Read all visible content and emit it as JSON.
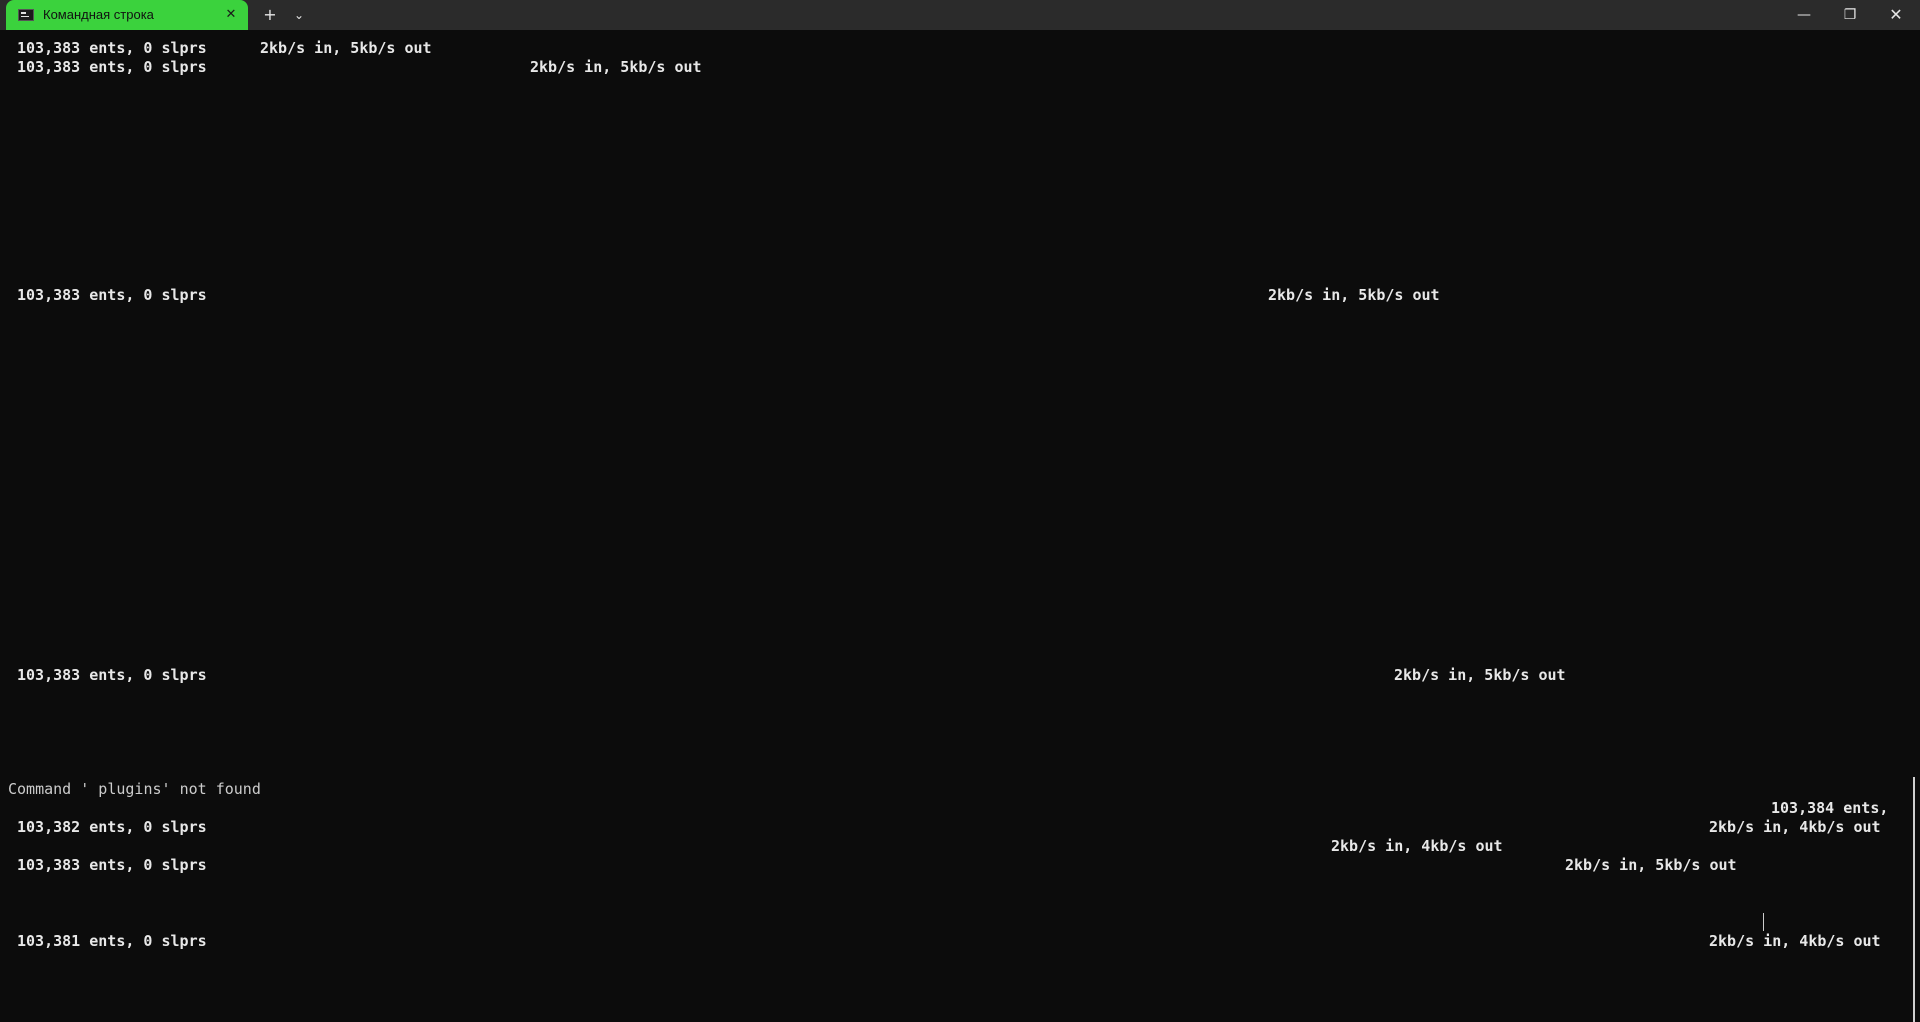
{
  "window": {
    "tab_title": "Командная строка",
    "tab_close_icon": "✕",
    "new_tab_icon": "+",
    "dropdown_icon": "⌄",
    "minimize_icon": "—",
    "maximize_icon": "❐",
    "close_icon": "✕",
    "accent_color": "#3bd23d"
  },
  "terminal": {
    "lines": [
      "103,383 ents, 0 slprs",
      "2kb/s in, 5kb/s out",
      "103,383 ents, 0 slprs",
      "2kb/s in, 5kb/s out",
      "103,383 ents, 0 slprs",
      "2kb/s in, 5kb/s out",
      "103,383 ents, 0 slprs",
      "2kb/s in, 5kb/s out",
      "Command ' plugins' not found",
      "103,384 ents,",
      "103,382 ents, 0 slprs",
      "2kb/s in, 4kb/s out",
      "2kb/s in, 4kb/s out",
      "103,383 ents, 0 slprs",
      "2kb/s in, 5kb/s out",
      "103,381 ents, 0 slprs",
      "2kb/s in, 4kb/s out"
    ]
  }
}
